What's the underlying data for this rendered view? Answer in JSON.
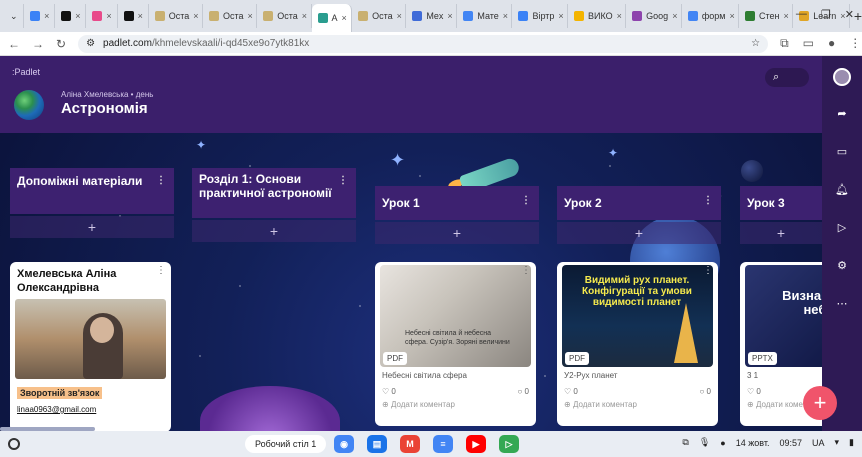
{
  "browser": {
    "tabs": [
      {
        "label": "",
        "color": "#3b82f6"
      },
      {
        "label": "",
        "color": "#111111"
      },
      {
        "label": "",
        "color": "#e84a8a"
      },
      {
        "label": "",
        "color": "#111111"
      },
      {
        "label": "Оста",
        "color": "#c9b070"
      },
      {
        "label": "Оста",
        "color": "#c9b070"
      },
      {
        "label": "Оста",
        "color": "#c9b070"
      },
      {
        "label": "А",
        "color": "#2a9d8f",
        "active": true
      },
      {
        "label": "Оста",
        "color": "#c9b070"
      },
      {
        "label": "Mex",
        "color": "#3f6bd8"
      },
      {
        "label": "Мате",
        "color": "#4285f4"
      },
      {
        "label": "Віртр",
        "color": "#3b82f6"
      },
      {
        "label": "ВИКО",
        "color": "#f4b400"
      },
      {
        "label": "Goog",
        "color": "#8e44ad"
      },
      {
        "label": "форм",
        "color": "#4285f4"
      },
      {
        "label": "Стен",
        "color": "#2e7d32"
      },
      {
        "label": "Learn",
        "color": "#e0a526"
      }
    ],
    "new_tab": "+",
    "url_site": "padlet.com",
    "url_path": "/khmelevskaali/i-qd45xe9o7ytk81kx"
  },
  "padlet": {
    "brand": ":Padlet",
    "author": "Аліна Хмелевська • день",
    "title": "Астрономія",
    "search_icon": "⌕",
    "columns": [
      {
        "title": "Допоміжні матеріали"
      },
      {
        "title": "Розділ 1: Основи практичної астрономії"
      },
      {
        "title": "Урок 1"
      },
      {
        "title": "Урок 2"
      },
      {
        "title": "Урок 3"
      }
    ],
    "add_symbol": "+",
    "card_profile": {
      "title": "Хмелевська Аліна Олександрівна",
      "feedback": "Зворотній зв'язок",
      "email": "linaa0963@gmail.com"
    },
    "card_lesson1": {
      "thumb_text": "Небесні світила й небесна сфера. Сузір'я. Зоряні величини",
      "tag": "PDF",
      "caption": "Небесні світила сфера",
      "likes": "0",
      "comments": "0",
      "add_comment": "Додати коментар"
    },
    "card_lesson2": {
      "thumb_text": "Видимий рух планет. Конфігурації та умови видимості планет",
      "tag": "PDF",
      "caption": "У2-Рух планет",
      "likes": "0",
      "comments": "0",
      "add_comment": "Додати коментар"
    },
    "card_lesson3": {
      "thumb_text": "Визна відст д небесн",
      "tag": "PPTX",
      "caption": "3 1",
      "likes": "0",
      "add_comment": "Додати коментар"
    },
    "fab": "+"
  },
  "taskbar": {
    "desk_label": "Робочий стіл 1",
    "apps": [
      {
        "name": "chrome",
        "color": "#4285f4"
      },
      {
        "name": "files",
        "color": "#1a73e8"
      },
      {
        "name": "gmail",
        "color": "#ea4335"
      },
      {
        "name": "docs",
        "color": "#4285f4"
      },
      {
        "name": "youtube",
        "color": "#ff0000"
      },
      {
        "name": "play",
        "color": "#34a853"
      }
    ],
    "date": "14 жовт.",
    "time": "09:57",
    "locale": "UA"
  }
}
